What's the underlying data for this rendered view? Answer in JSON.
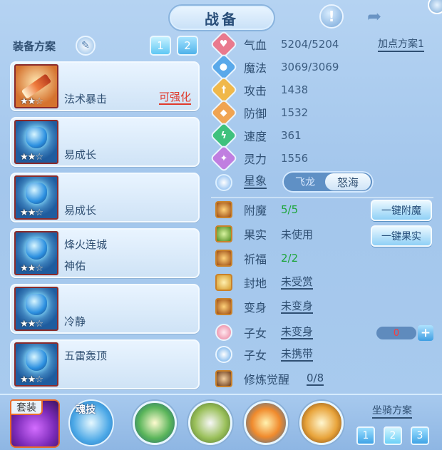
{
  "header": {
    "title": "战备",
    "alert_icon": "exclamation-icon",
    "share_icon": "share-icon"
  },
  "left_panel": {
    "title": "装备方案",
    "plan_buttons": [
      "1",
      "2"
    ],
    "slots": [
      {
        "name": "法术暴击",
        "stars": 2,
        "max_stars": 3,
        "tag": "可强化",
        "icon": "wand"
      },
      {
        "name": "易成长",
        "stars": 2,
        "max_stars": 3,
        "icon": "helm"
      },
      {
        "name": "易成长",
        "stars": 2,
        "max_stars": 3,
        "icon": "armor"
      },
      {
        "name": "烽火连城",
        "sub": "神佑",
        "stars": 2,
        "max_stars": 3,
        "icon": "necklace"
      },
      {
        "name": "冷静",
        "stars": 2,
        "max_stars": 3,
        "icon": "belt"
      },
      {
        "name": "五雷轰顶",
        "stars": 2,
        "max_stars": 3,
        "icon": "boots"
      }
    ]
  },
  "stats": {
    "plan_link": "加点方案1",
    "rows": [
      {
        "label": "气血",
        "value": "5204/5204",
        "color": "#e97a8e"
      },
      {
        "label": "魔法",
        "value": "3069/3069",
        "color": "#5aa9ea"
      },
      {
        "label": "攻击",
        "value": "1438",
        "color": "#f0b84a"
      },
      {
        "label": "防御",
        "value": "1532",
        "color": "#f0a452"
      },
      {
        "label": "速度",
        "value": "361",
        "color": "#3fc17d"
      },
      {
        "label": "灵力",
        "value": "1556",
        "color": "#c07ee0"
      }
    ],
    "star": {
      "label": "星象",
      "options": [
        "飞龙",
        "怒海"
      ],
      "selected": "怒海"
    }
  },
  "attributes": {
    "rows": [
      {
        "label": "附魔",
        "value": "5/5",
        "style": "green"
      },
      {
        "label": "果实",
        "value": "未使用",
        "style": "plain"
      },
      {
        "label": "祈福",
        "value": "2/2",
        "style": "green"
      },
      {
        "label": "封地",
        "value": "未受赏",
        "style": "ul"
      },
      {
        "label": "变身",
        "value": "未变身",
        "style": "ul"
      },
      {
        "label": "子女",
        "value": "未变身",
        "style": "ul"
      },
      {
        "label": "子女",
        "value": "未携带",
        "style": "ul"
      },
      {
        "label": "修炼觉醒",
        "value": "0/8",
        "style": "ul"
      }
    ],
    "buttons": {
      "enchant": "一键附魔",
      "fruit": "一键果实"
    },
    "counter": {
      "value": "0",
      "plus": "+"
    }
  },
  "bottom": {
    "set_label": "套装",
    "soul_label": "魂技",
    "mount_title": "坐骑方案",
    "mount_buttons": [
      "1",
      "2",
      "3"
    ]
  }
}
